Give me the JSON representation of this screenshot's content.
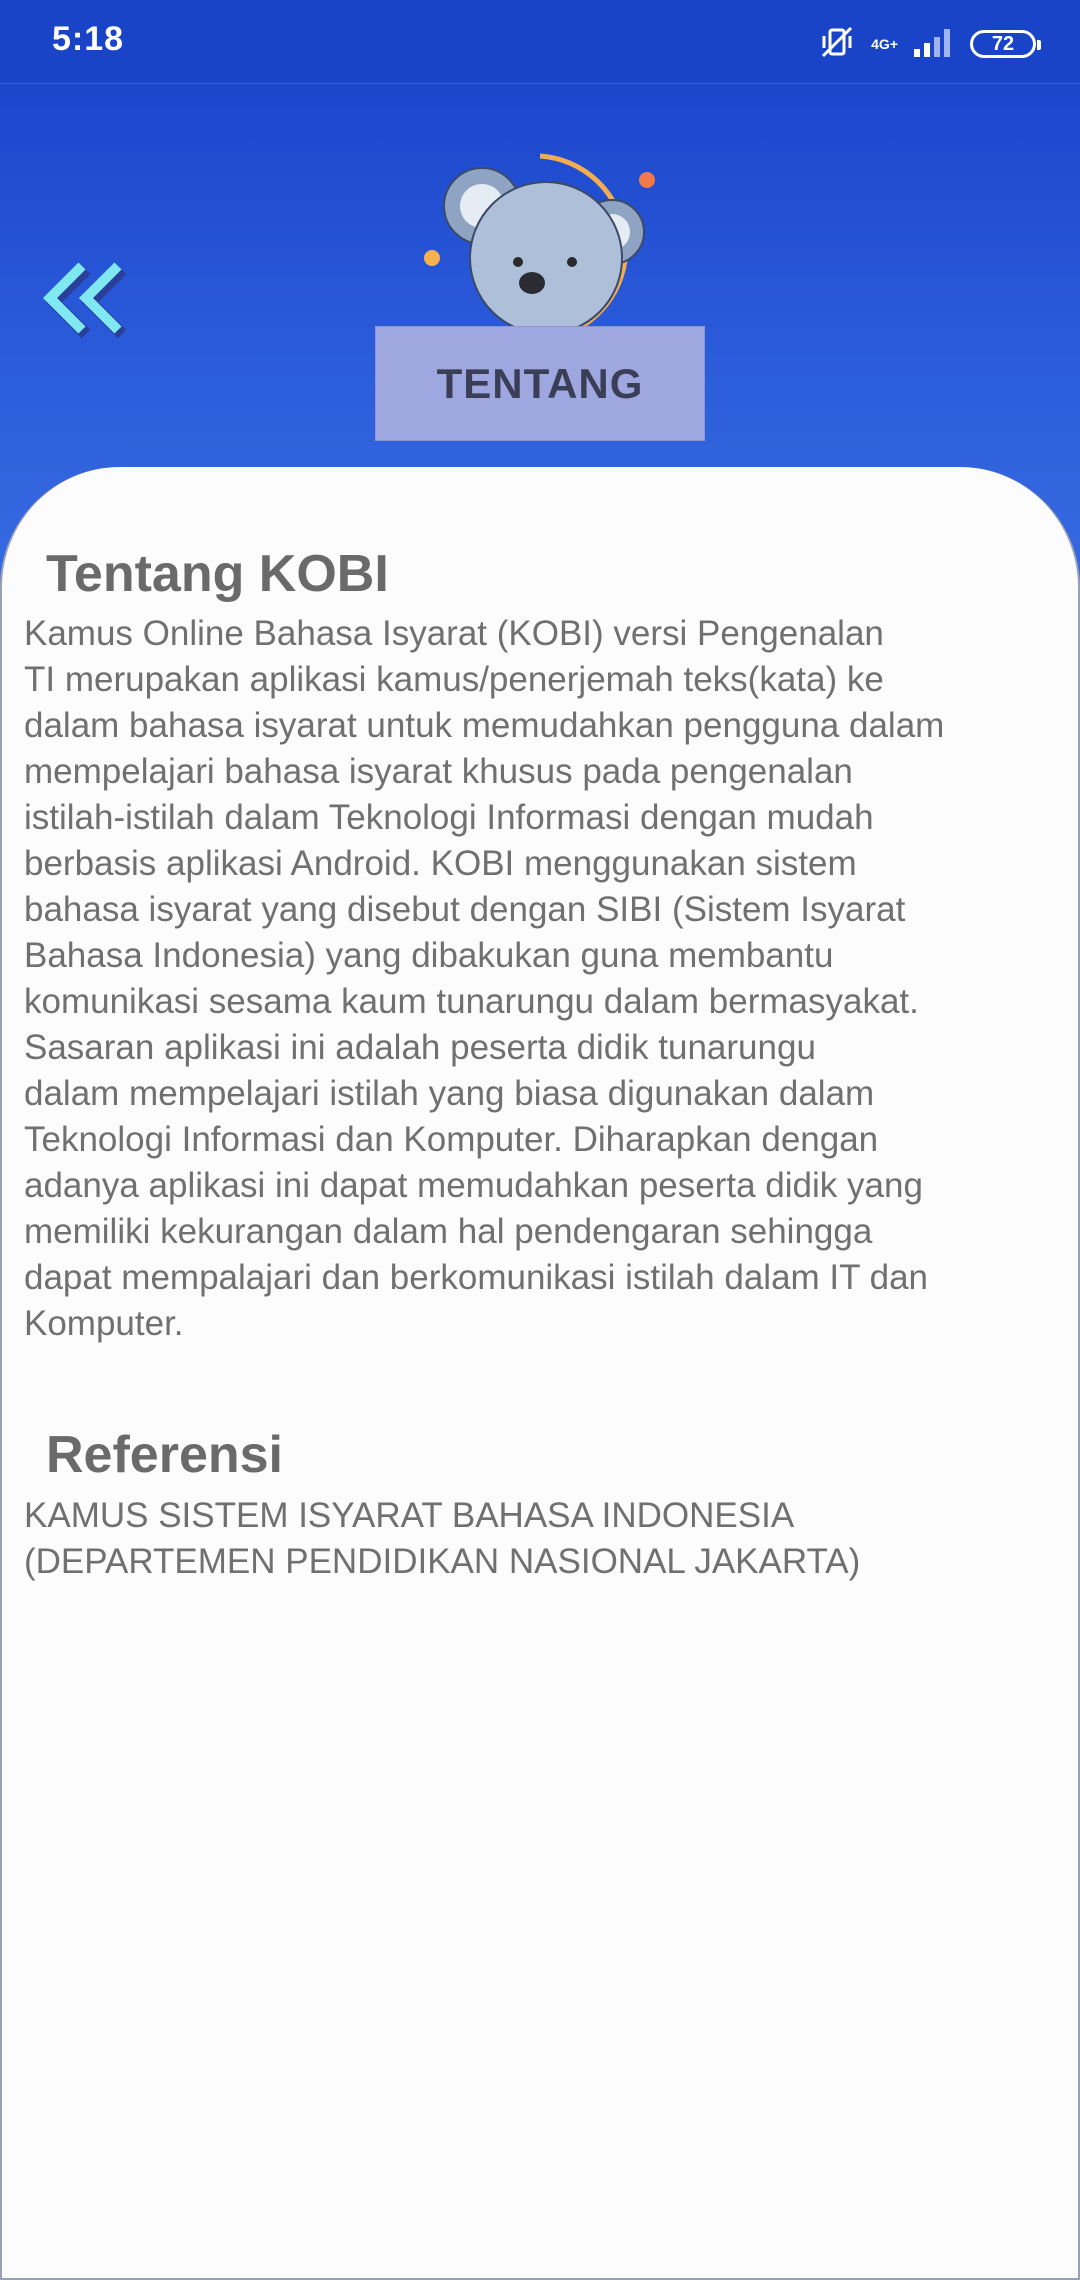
{
  "status_bar": {
    "time": "5:18",
    "network": "4G+",
    "battery": "72"
  },
  "header": {
    "title": "TENTANG"
  },
  "about": {
    "heading": "Tentang KOBI",
    "lines": [
      "Kamus Online Bahasa Isyarat (KOBI) versi Pengenalan",
      "TI merupakan aplikasi kamus/penerjemah teks(kata) ke",
      "dalam bahasa isyarat untuk memudahkan pengguna dalam",
      "mempelajari bahasa isyarat khusus pada pengenalan",
      "istilah-istilah dalam Teknologi Informasi dengan mudah",
      "berbasis aplikasi Android. KOBI menggunakan sistem",
      "bahasa isyarat yang disebut dengan SIBI (Sistem Isyarat",
      "Bahasa Indonesia) yang dibakukan guna membantu",
      "komunikasi sesama kaum tunarungu dalam bermasyakat.",
      "Sasaran aplikasi ini adalah peserta didik tunarungu",
      "dalam mempelajari istilah yang biasa digunakan dalam",
      "Teknologi Informasi dan Komputer. Diharapkan dengan",
      "adanya aplikasi ini dapat memudahkan peserta didik yang",
      "memiliki kekurangan dalam hal pendengaran sehingga",
      "dapat mempalajari dan berkomunikasi istilah dalam IT dan",
      "Komputer."
    ]
  },
  "references": {
    "heading": "Referensi",
    "lines": [
      "KAMUS SISTEM ISYARAT BAHASA INDONESIA",
      "(DEPARTEMEN PENDIDIKAN NASIONAL JAKARTA)"
    ]
  },
  "icons": {
    "back": "double-chevron-left-icon",
    "mascot": "koala-mascot-icon",
    "mute": "vibrate-off-icon",
    "signal": "signal-bars-icon",
    "battery": "battery-icon"
  },
  "colors": {
    "header_blue": "#1a44c8",
    "title_box": "#9ea7df",
    "back_arrow": "#7fe8f0",
    "text_gray": "#707070"
  }
}
